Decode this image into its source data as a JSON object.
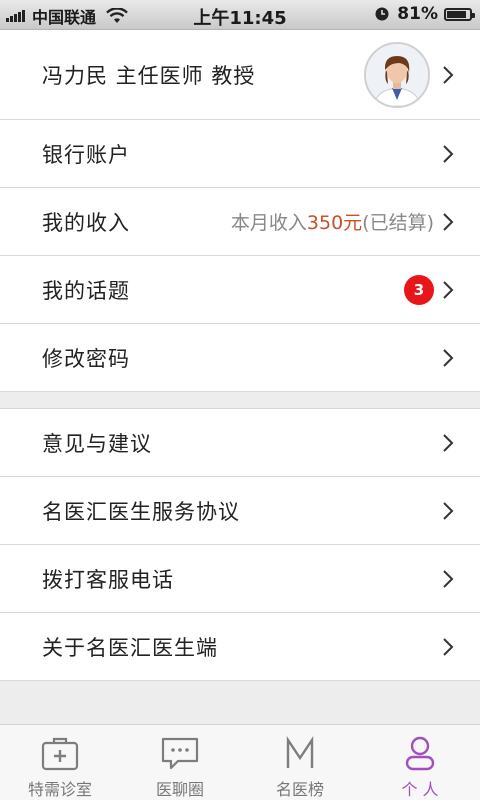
{
  "status_bar": {
    "carrier": "中国联通",
    "time": "上午11:45",
    "battery_pct": "81%",
    "battery_level": 0.81,
    "icons": [
      "signal-icon",
      "wifi-icon",
      "alarm-icon",
      "battery-icon"
    ]
  },
  "profile": {
    "name": "冯力民 主任医师 教授",
    "avatar": "doctor-avatar"
  },
  "group1": [
    {
      "label": "银行账户"
    },
    {
      "label": "我的收入",
      "detail_prefix": "本月收入",
      "detail_amount": "350元",
      "detail_suffix": "(已结算)"
    },
    {
      "label": "我的话题",
      "badge": "3"
    },
    {
      "label": "修改密码"
    }
  ],
  "group2": [
    {
      "label": "意见与建议"
    },
    {
      "label": "名医汇医生服务协议"
    },
    {
      "label": "拨打客服电话"
    },
    {
      "label": "关于名医汇医生端"
    }
  ],
  "tabs": [
    {
      "label": "特需诊室",
      "icon": "medical-kit-icon",
      "active": false
    },
    {
      "label": "医聊圈",
      "icon": "chat-bubble-icon",
      "active": false
    },
    {
      "label": "名医榜",
      "icon": "letter-m-icon",
      "active": false
    },
    {
      "label": "个 人",
      "icon": "person-icon",
      "active": true
    }
  ],
  "colors": {
    "accent": "#a14fbd",
    "income_amount": "#c8502a",
    "badge": "#e8151b",
    "background": "#ededed"
  }
}
